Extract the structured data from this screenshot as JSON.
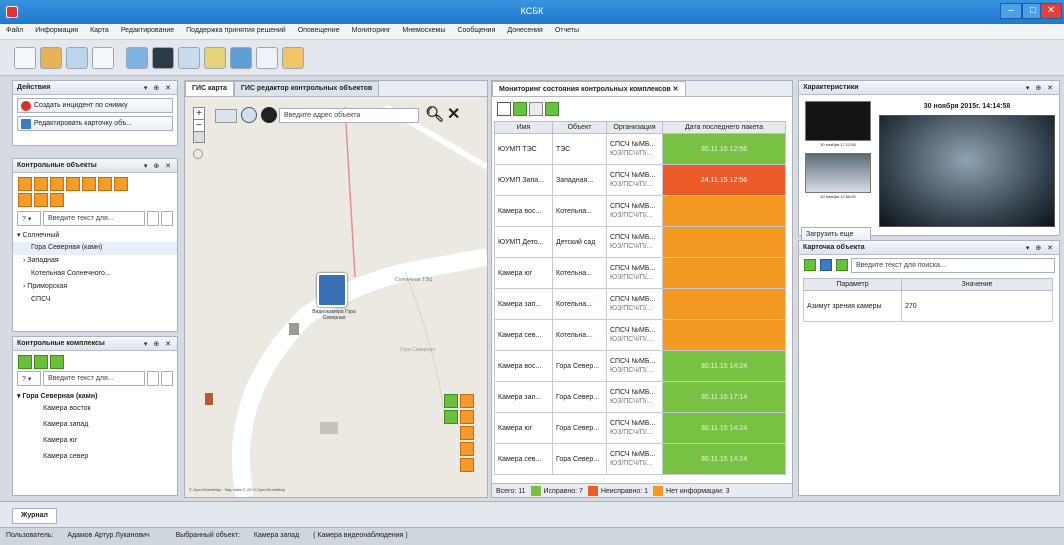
{
  "app": {
    "title": "КСБК",
    "win_min": "–",
    "win_max": "□",
    "win_close": "✕"
  },
  "menu": [
    "Файл",
    "Информация",
    "Карта",
    "Редактирование",
    "Поддержка принятия решений",
    "Оповещение",
    "Мониторинг",
    "Мнемосхемы",
    "Сообщения",
    "Донесения",
    "Отчеты"
  ],
  "actions": {
    "title": "Действия",
    "create": "Создать инцидент по снимку",
    "edit": "Редактировать карточку объ..."
  },
  "control_objects": {
    "title": "Контрольные объекты",
    "search_placeholder": "Введите текст для...",
    "tree": [
      "Солнечный",
      "Гора Северная (камн)",
      "Западная",
      "Котельная Солнечного...",
      "Приморская",
      "СПСЧ"
    ]
  },
  "control_complexes": {
    "title": "Контрольные комплексы",
    "search_placeholder": "Введите текст для...",
    "tree": [
      "Гора Северная (камн)",
      "Камера восток",
      "Камера запад",
      "Камера юг",
      "Камера север"
    ]
  },
  "map": {
    "tabs": [
      "ГИС карта",
      "ГИС редактор контрольных объектов"
    ],
    "address_placeholder": "Введите адрес объекта",
    "plus": "+",
    "minus": "−",
    "marker_label": "Видеокамера Гора Северная",
    "label_south": "Солнечная ТЭЦ",
    "label_road": "Гора Северная",
    "credit": "© OpenStreetMap · Map data © 2013 OpenStreetMap"
  },
  "monitoring": {
    "tab": "Мониторинг состояния контрольных комплексов",
    "columns": [
      "Имя",
      "Объект",
      "Организация",
      "Дата последнего пакета"
    ],
    "rows": [
      {
        "name": "ЮУМП ТЭС",
        "obj": "ТЭС",
        "org": "СПСЧ №МБ...",
        "org2": "ЮЗ/ПСЧ/П/...",
        "date": "30.11.15 12:56",
        "status": "green"
      },
      {
        "name": "ЮУМП Запа...",
        "obj": "Западная...",
        "org": "СПСЧ №МБ...",
        "org2": "ЮЗ/ПСЧ/П/...",
        "date": "24.11.15 12:56",
        "status": "red"
      },
      {
        "name": "Камера вос...",
        "obj": "Котельна...",
        "org": "СПСЧ №МБ...",
        "org2": "ЮЗ/ПСЧ/П/...",
        "date": "",
        "status": "orange"
      },
      {
        "name": "ЮУМП Дето...",
        "obj": "Детский сад",
        "org": "СПСЧ №МБ...",
        "org2": "ЮЗ/ПСЧ/П/...",
        "date": "",
        "status": "orange"
      },
      {
        "name": "Камера юг",
        "obj": "Котельна...",
        "org": "СПСЧ №МБ...",
        "org2": "ЮЗ/ПСЧ/П/...",
        "date": "",
        "status": "orange"
      },
      {
        "name": "Камера зап...",
        "obj": "Котельна...",
        "org": "СПСЧ №МБ...",
        "org2": "ЮЗ/ПСЧ/П/...",
        "date": "",
        "status": "orange"
      },
      {
        "name": "Камера сев...",
        "obj": "Котельна...",
        "org": "СПСЧ №МБ...",
        "org2": "ЮЗ/ПСЧ/П/...",
        "date": "",
        "status": "orange"
      },
      {
        "name": "Камера вос...",
        "obj": "Гора Север...",
        "org": "СПСЧ №МБ...",
        "org2": "ЮЗ/ПСЧ/П/...",
        "date": "30.11.15 14:24",
        "status": "green"
      },
      {
        "name": "Камера зап...",
        "obj": "Гора Север...",
        "org": "СПСЧ №МБ...",
        "org2": "ЮЗ/ПСЧ/П/...",
        "date": "30.11.15 17:14",
        "status": "green"
      },
      {
        "name": "Камера юг",
        "obj": "Гора Север...",
        "org": "СПСЧ №МБ...",
        "org2": "ЮЗ/ПСЧ/П/...",
        "date": "30.11.15 14:24",
        "status": "green"
      },
      {
        "name": "Камера сев...",
        "obj": "Гора Север...",
        "org": "СПСЧ №МБ...",
        "org2": "ЮЗ/ПСЧ/П/...",
        "date": "30.11.15 14:24",
        "status": "green"
      }
    ],
    "footer": {
      "total_label": "Всего:",
      "total": "11",
      "ok_label": "Исправно:",
      "ok": "7",
      "bad_label": "Неисправно:",
      "bad": "1",
      "noinfo_label": "Нет информации:",
      "noinfo": "3"
    },
    "colors": {
      "green": "#79c142",
      "red": "#ee5b2a",
      "orange": "#f49a22"
    }
  },
  "characteristics": {
    "title": "Характеристики",
    "datetime": "30 ноября 2015г. 14:14:58",
    "thumb1": "30 ноября 17:12:56",
    "thumb2": "30 ноября 12:56:00",
    "load_btn": "Загрузить еще"
  },
  "card": {
    "title": "Карточка объекта",
    "search_placeholder": "Введите текст для поиска...",
    "col_param": "Параметр",
    "col_value": "Значение",
    "param": "Азимут зрения камеры",
    "value": "270"
  },
  "journal": {
    "tab": "Журнал"
  },
  "status": {
    "user_label": "Пользователь:",
    "user": "Адамов Артур Луканович",
    "sel_label": "Выбранный объект:",
    "sel": "Камера запад",
    "sel_type": "( Камера видеонаблюдения )"
  }
}
